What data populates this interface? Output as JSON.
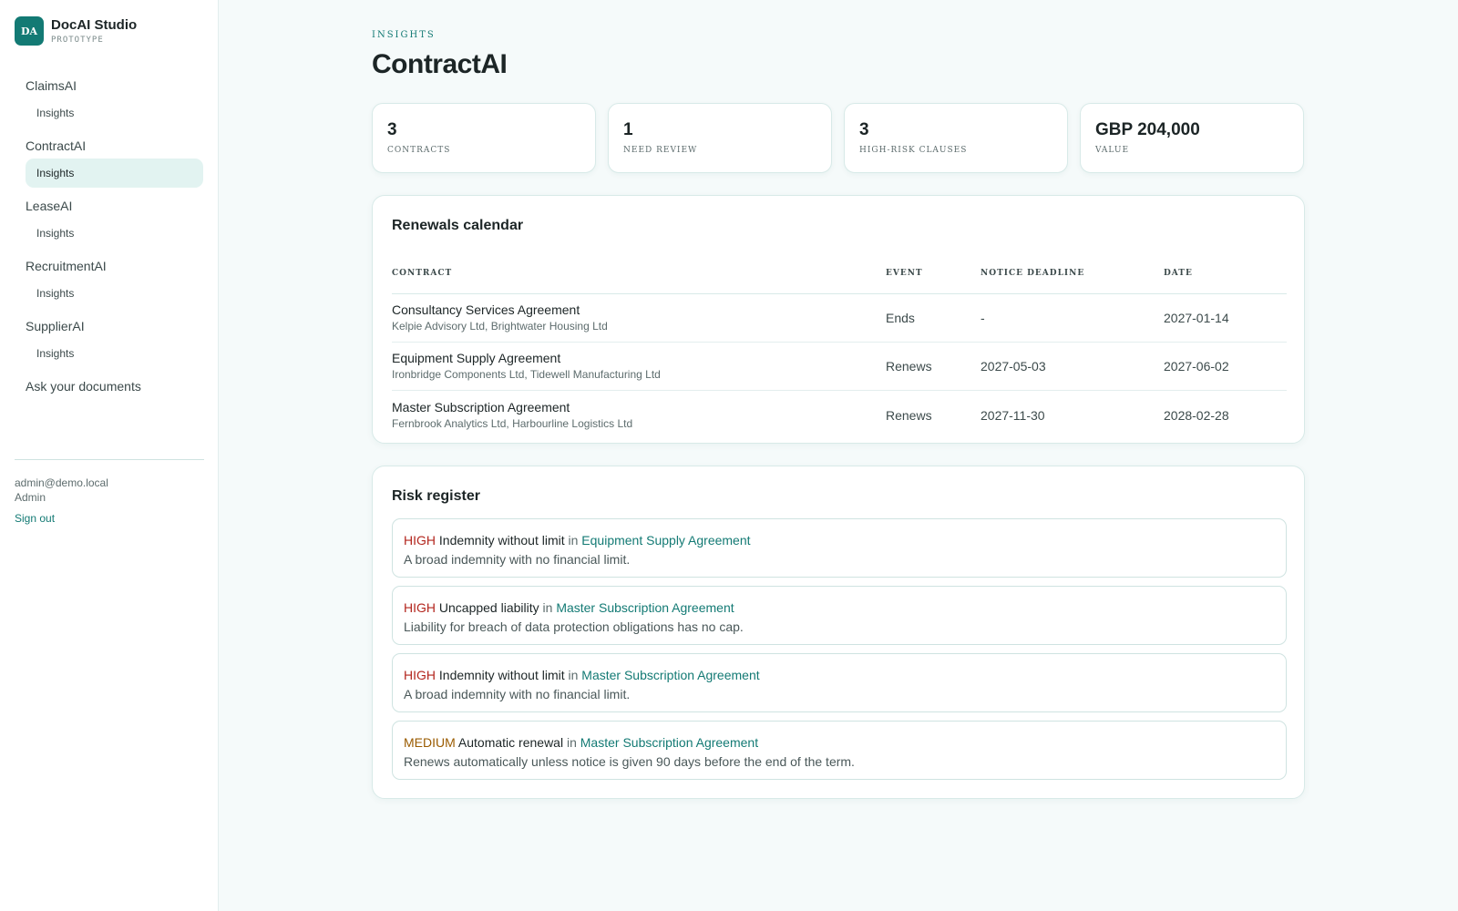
{
  "brand": {
    "initials": "DA",
    "name": "DocAI Studio",
    "tag": "PROTOTYPE"
  },
  "nav": {
    "groups": [
      {
        "label": "ClaimsAI",
        "sub": "Insights"
      },
      {
        "label": "ContractAI",
        "sub": "Insights"
      },
      {
        "label": "LeaseAI",
        "sub": "Insights"
      },
      {
        "label": "RecruitmentAI",
        "sub": "Insights"
      },
      {
        "label": "SupplierAI",
        "sub": "Insights"
      }
    ],
    "ask": "Ask your documents"
  },
  "user": {
    "email": "admin@demo.local",
    "role": "Admin",
    "sign_out": "Sign out"
  },
  "header": {
    "eyebrow": "INSIGHTS",
    "title": "ContractAI"
  },
  "stats": [
    {
      "value": "3",
      "label": "CONTRACTS"
    },
    {
      "value": "1",
      "label": "NEED REVIEW"
    },
    {
      "value": "3",
      "label": "HIGH-RISK CLAUSES"
    },
    {
      "value": "GBP 204,000",
      "label": "VALUE"
    }
  ],
  "renewals": {
    "title": "Renewals calendar",
    "columns": [
      "CONTRACT",
      "EVENT",
      "NOTICE DEADLINE",
      "DATE"
    ],
    "rows": [
      {
        "name": "Consultancy Services Agreement",
        "parties": "Kelpie Advisory Ltd, Brightwater Housing Ltd",
        "event": "Ends",
        "notice": "-",
        "date": "2027-01-14"
      },
      {
        "name": "Equipment Supply Agreement",
        "parties": "Ironbridge Components Ltd, Tidewell Manufacturing Ltd",
        "event": "Renews",
        "notice": "2027-05-03",
        "date": "2027-06-02"
      },
      {
        "name": "Master Subscription Agreement",
        "parties": "Fernbrook Analytics Ltd, Harbourline Logistics Ltd",
        "event": "Renews",
        "notice": "2027-11-30",
        "date": "2028-02-28"
      }
    ]
  },
  "risk": {
    "title": "Risk register",
    "in_word": "in",
    "items": [
      {
        "severity": "HIGH",
        "clause": "Indemnity without limit",
        "contract": "Equipment Supply Agreement",
        "desc": "A broad indemnity with no financial limit."
      },
      {
        "severity": "HIGH",
        "clause": "Uncapped liability",
        "contract": "Master Subscription Agreement",
        "desc": "Liability for breach of data protection obligations has no cap."
      },
      {
        "severity": "HIGH",
        "clause": "Indemnity without limit",
        "contract": "Master Subscription Agreement",
        "desc": "A broad indemnity with no financial limit."
      },
      {
        "severity": "MEDIUM",
        "clause": "Automatic renewal",
        "contract": "Master Subscription Agreement",
        "desc": "Renews automatically unless notice is given 90 days before the end of the term."
      }
    ]
  },
  "colors": {
    "accent": "#137a74",
    "high": "#b3261e",
    "medium": "#9a5b00",
    "background": "#f5fafa"
  }
}
